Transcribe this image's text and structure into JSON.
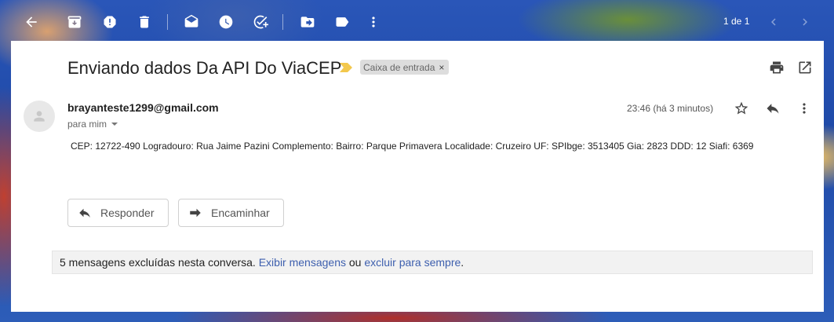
{
  "toolbar": {
    "icons": [
      "back-arrow-icon",
      "archive-icon",
      "report-spam-icon",
      "delete-icon",
      "mark-unread-icon",
      "snooze-icon",
      "add-task-icon",
      "move-to-icon",
      "label-icon",
      "more-vert-icon"
    ],
    "pager_text": "1 de 1"
  },
  "email": {
    "subject": "Enviando dados Da API Do ViaCEP",
    "label": "Caixa de entrada",
    "label_remove": "×",
    "sender": "brayanteste1299@gmail.com",
    "recipient": "para mim",
    "timestamp": "23:46 (há 3 minutos)",
    "body": "CEP: 12722-490 Logradouro: Rua Jaime Pazini Complemento: Bairro: Parque Primavera Localidade: Cruzeiro UF: SPIbge: 3513405 Gia: 2823 DDD: 12 Siafi: 6369"
  },
  "actions": {
    "reply_label": "Responder",
    "forward_label": "Encaminhar"
  },
  "deleted_notice": {
    "text": "5 mensagens excluídas nesta conversa.",
    "show_link": "Exibir mensagens",
    "or_text": "ou",
    "delete_link": "excluir para sempre",
    "end": "."
  },
  "colors": {
    "link": "#3d5fae",
    "importance_marker": "#f3c84d",
    "label_chip_bg": "#dddddd"
  }
}
